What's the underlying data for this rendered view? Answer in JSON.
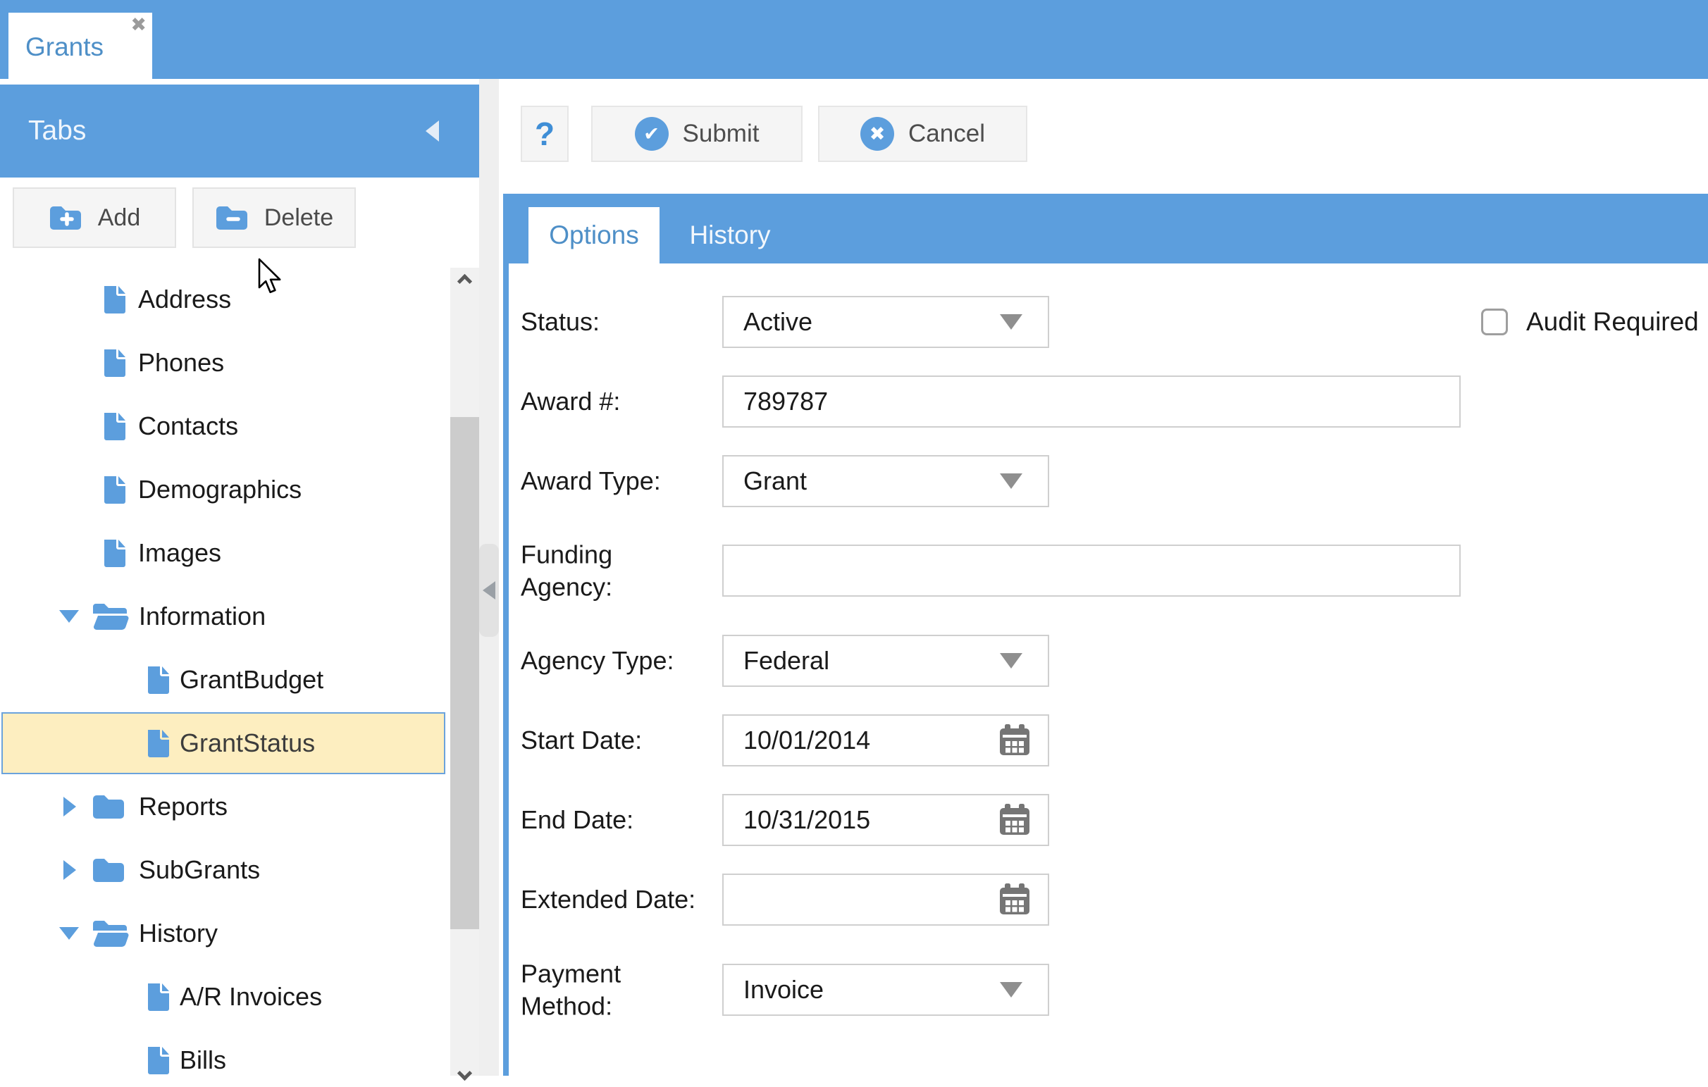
{
  "window": {
    "tab_title": "Grants"
  },
  "icons": {
    "close_x": "✖",
    "submit_check": "✔",
    "cancel_x": "✖"
  },
  "colors": {
    "accent_blue": "#5C9EDD",
    "tab_text_blue": "#4E8FC7",
    "selection_bg": "#FDEEC0",
    "selection_border": "#6BA3DC",
    "button_bg": "#F5F5F5",
    "control_border": "#CFCFCF",
    "icon_gray": "#757575"
  },
  "sidebar": {
    "title": "Tabs",
    "add_label": "Add",
    "delete_label": "Delete",
    "tree": [
      {
        "label": "Address",
        "type": "doc",
        "level": 1
      },
      {
        "label": "Phones",
        "type": "doc",
        "level": 1
      },
      {
        "label": "Contacts",
        "type": "doc",
        "level": 1
      },
      {
        "label": "Demographics",
        "type": "doc",
        "level": 1
      },
      {
        "label": "Images",
        "type": "doc",
        "level": 1
      },
      {
        "label": "Information",
        "type": "folder",
        "level": 1,
        "expanded": true
      },
      {
        "label": "GrantBudget",
        "type": "doc",
        "level": 2
      },
      {
        "label": "GrantStatus",
        "type": "doc",
        "level": 2,
        "selected": true
      },
      {
        "label": "Reports",
        "type": "folder",
        "level": 1,
        "expanded": false
      },
      {
        "label": "SubGrants",
        "type": "folder",
        "level": 1,
        "expanded": false
      },
      {
        "label": "History",
        "type": "folder",
        "level": 1,
        "expanded": true
      },
      {
        "label": "A/R Invoices",
        "type": "doc",
        "level": 2
      },
      {
        "label": "Bills",
        "type": "doc",
        "level": 2
      }
    ]
  },
  "toolbar": {
    "help_label": "?",
    "submit_label": "Submit",
    "cancel_label": "Cancel"
  },
  "main": {
    "tabs": [
      {
        "label": "Options",
        "active": true
      },
      {
        "label": "History",
        "active": false
      }
    ],
    "form": {
      "fields": [
        {
          "label": "Status:",
          "type": "select",
          "value": "Active",
          "width": "narrow"
        },
        {
          "label": "Award #:",
          "type": "text",
          "value": "789787",
          "width": "wide"
        },
        {
          "label": "Award Type:",
          "type": "select",
          "value": "Grant",
          "width": "narrow"
        },
        {
          "label": "Funding Agency:",
          "type": "text",
          "value": "",
          "width": "wide",
          "wrap": true
        },
        {
          "label": "Agency Type:",
          "type": "select",
          "value": "Federal",
          "width": "narrow"
        },
        {
          "label": "Start Date:",
          "type": "date",
          "value": "10/01/2014",
          "width": "narrow"
        },
        {
          "label": "End Date:",
          "type": "date",
          "value": "10/31/2015",
          "width": "narrow"
        },
        {
          "label": "Extended Date:",
          "type": "date",
          "value": "",
          "width": "narrow"
        },
        {
          "label": "Payment Method:",
          "type": "select",
          "value": "Invoice",
          "width": "narrow",
          "wrap": true
        }
      ],
      "checkbox": {
        "label": "Audit Required",
        "checked": false
      }
    }
  }
}
